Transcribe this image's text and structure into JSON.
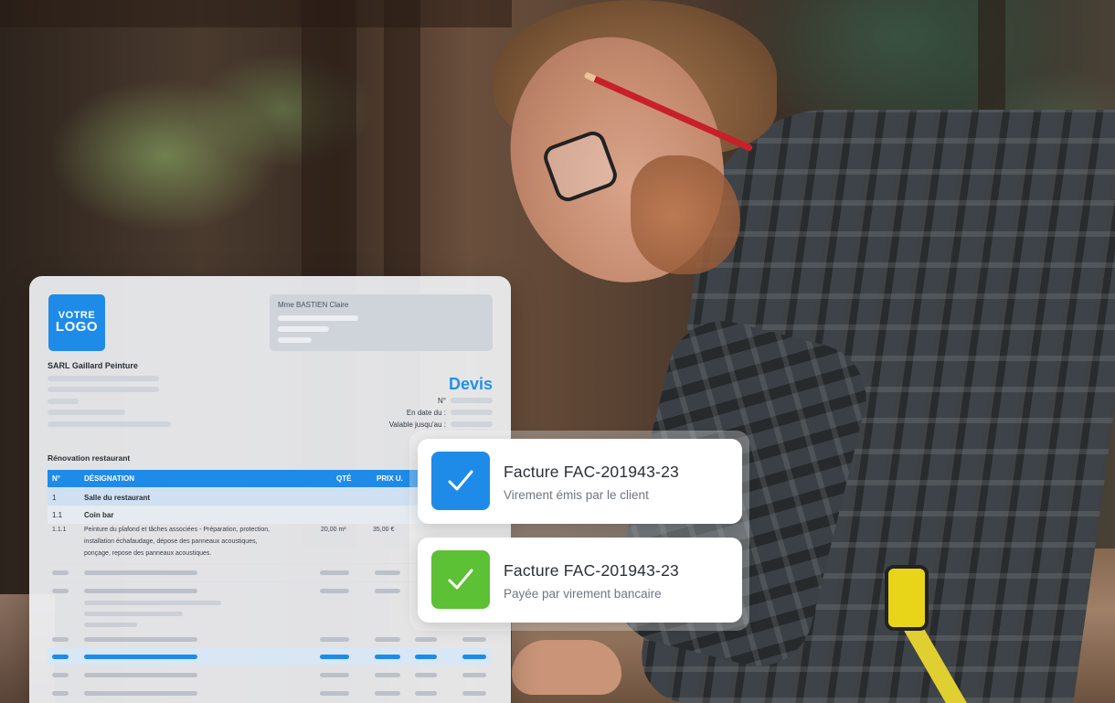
{
  "document": {
    "logo_line1": "VOTRE",
    "logo_line2": "LOGO",
    "company_name": "SARL Gaillard Peinture",
    "client_name": "Mme BASTIEN Claire",
    "doc_type": "Devis",
    "meta_labels": [
      "N°",
      "En date du :",
      "Valable jusqu'au :"
    ],
    "project_title": "Rénovation restaurant",
    "table_headers": {
      "num": "N°",
      "designation": "DÉSIGNATION",
      "qty": "QTÉ",
      "unit_price": "PRIX U."
    },
    "section_row": {
      "num": "1",
      "label": "Salle du restaurant"
    },
    "subsection_row": {
      "num": "1.1",
      "label": "Coin bar"
    },
    "item_row": {
      "num": "1.1.1",
      "line1": "Peinture du plafond et tâches associées - Préparation, protection,",
      "line2": "installation échafaudage, dépose des panneaux acoustiques,",
      "line3": "ponçage, repose des panneaux acoustiques.",
      "qty": "20,00 m²",
      "unit_price": "35,00 €"
    }
  },
  "notifications": [
    {
      "title": "Facture FAC-201943-23",
      "subtitle": "Virement émis par le client",
      "icon": "check-icon",
      "color": "#1f8be8"
    },
    {
      "title": "Facture FAC-201943-23",
      "subtitle": "Payée par virement bancaire",
      "icon": "check-icon",
      "color": "#5cc134"
    }
  ]
}
